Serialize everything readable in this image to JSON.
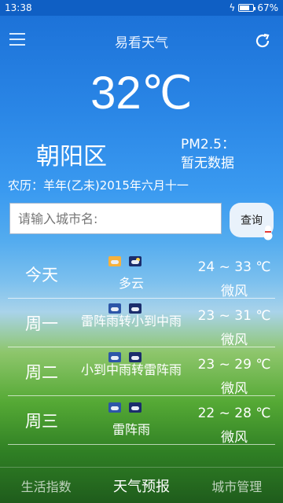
{
  "status_bar": {
    "time": "13:38",
    "battery": "67%",
    "battery_level": 0.67
  },
  "app_bar": {
    "title": "易看天气"
  },
  "current": {
    "temperature": "32℃",
    "district": "朝阳区",
    "pm_label": "PM2.5：",
    "pm_value": "暂无数据",
    "lunar_date": "农历：羊年(乙未)2015年六月十一"
  },
  "search": {
    "placeholder": "请输入城市名:",
    "button_label": "查询"
  },
  "forecast": [
    {
      "day": "今天",
      "desc": "多云",
      "range": "24 ~ 33 ℃",
      "wind": "微风",
      "icon_day": "cloudy-sun-icon",
      "icon_night": "cloudy-moon-icon"
    },
    {
      "day": "周一",
      "desc": "雷阵雨转小到中雨",
      "range": "23 ~ 31 ℃",
      "wind": "微风",
      "icon_day": "thunderstorm-icon",
      "icon_night": "rain-icon"
    },
    {
      "day": "周二",
      "desc": "小到中雨转雷阵雨",
      "range": "23 ~ 29 ℃",
      "wind": "微风",
      "icon_day": "rain-icon",
      "icon_night": "thunderstorm-icon"
    },
    {
      "day": "周三",
      "desc": "雷阵雨",
      "range": "22 ~ 28 ℃",
      "wind": "微风",
      "icon_day": "thunderstorm-icon",
      "icon_night": "thunderstorm-icon"
    }
  ],
  "bottom_nav": {
    "life_index": "生活指数",
    "forecast": "天气预报",
    "city_manage": "城市管理"
  }
}
